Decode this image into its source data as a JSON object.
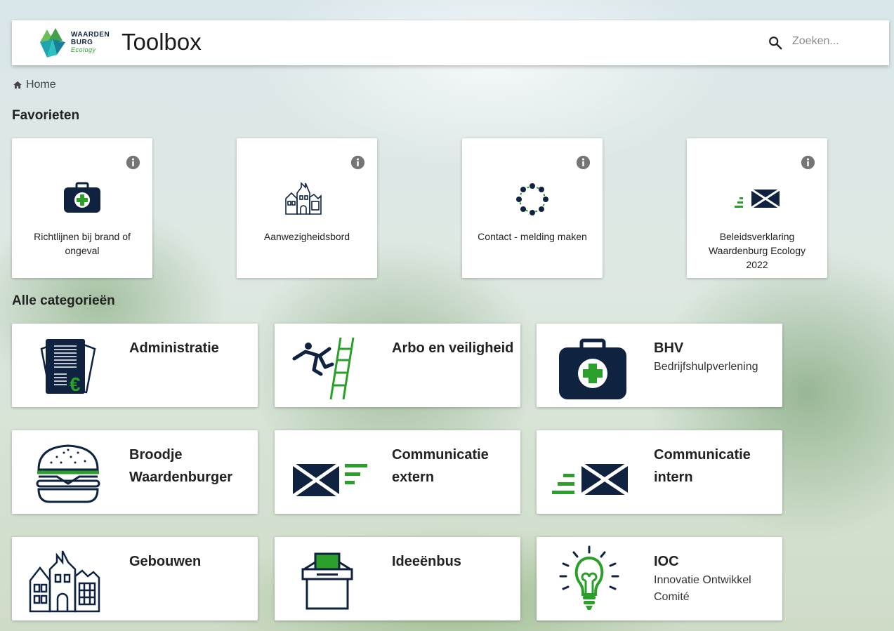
{
  "header": {
    "logo_text": [
      "WAARDEN",
      "BURG",
      "Ecology"
    ],
    "app_title": "Toolbox",
    "search": {
      "placeholder": "Zoeken...",
      "value": "",
      "icon": "search-icon"
    }
  },
  "breadcrumb": {
    "home_label": "Home",
    "icon": "home-icon"
  },
  "favorites": {
    "title": "Favorieten",
    "items": [
      {
        "label": "Richtlijnen bij brand of ongeval",
        "icon": "first-aid-kit-icon"
      },
      {
        "label": "Aanwezigheidsbord",
        "icon": "buildings-icon"
      },
      {
        "label": "Contact - melding maken",
        "icon": "people-circle-icon"
      },
      {
        "label": "Beleidsverklaring Waardenburg Ecology 2022",
        "icon": "envelope-send-icon"
      }
    ]
  },
  "categories": {
    "title": "Alle categorieën",
    "items": [
      {
        "title": "Administratie",
        "subtitle": "",
        "icon": "invoice-icon"
      },
      {
        "title": "Arbo en veiligheid",
        "subtitle": "",
        "icon": "falling-ladder-icon"
      },
      {
        "title": "BHV",
        "subtitle": "Bedrijfshulpverlening",
        "icon": "first-aid-kit-icon"
      },
      {
        "title": "Broodje Waardenburger",
        "subtitle": "",
        "icon": "burger-icon"
      },
      {
        "title": "Communicatie extern",
        "subtitle": "",
        "icon": "envelope-out-icon"
      },
      {
        "title": "Communicatie intern",
        "subtitle": "",
        "icon": "envelope-in-icon"
      },
      {
        "title": "Gebouwen",
        "subtitle": "",
        "icon": "buildings-icon"
      },
      {
        "title": "Ideeënbus",
        "subtitle": "",
        "icon": "ballot-box-icon"
      },
      {
        "title": "IOC",
        "subtitle": "Innovatie Ontwikkel Comité",
        "icon": "lightbulb-icon"
      }
    ]
  },
  "colors": {
    "navy": "#0f2340",
    "green": "#2aa02a",
    "info_grey": "#757575"
  }
}
